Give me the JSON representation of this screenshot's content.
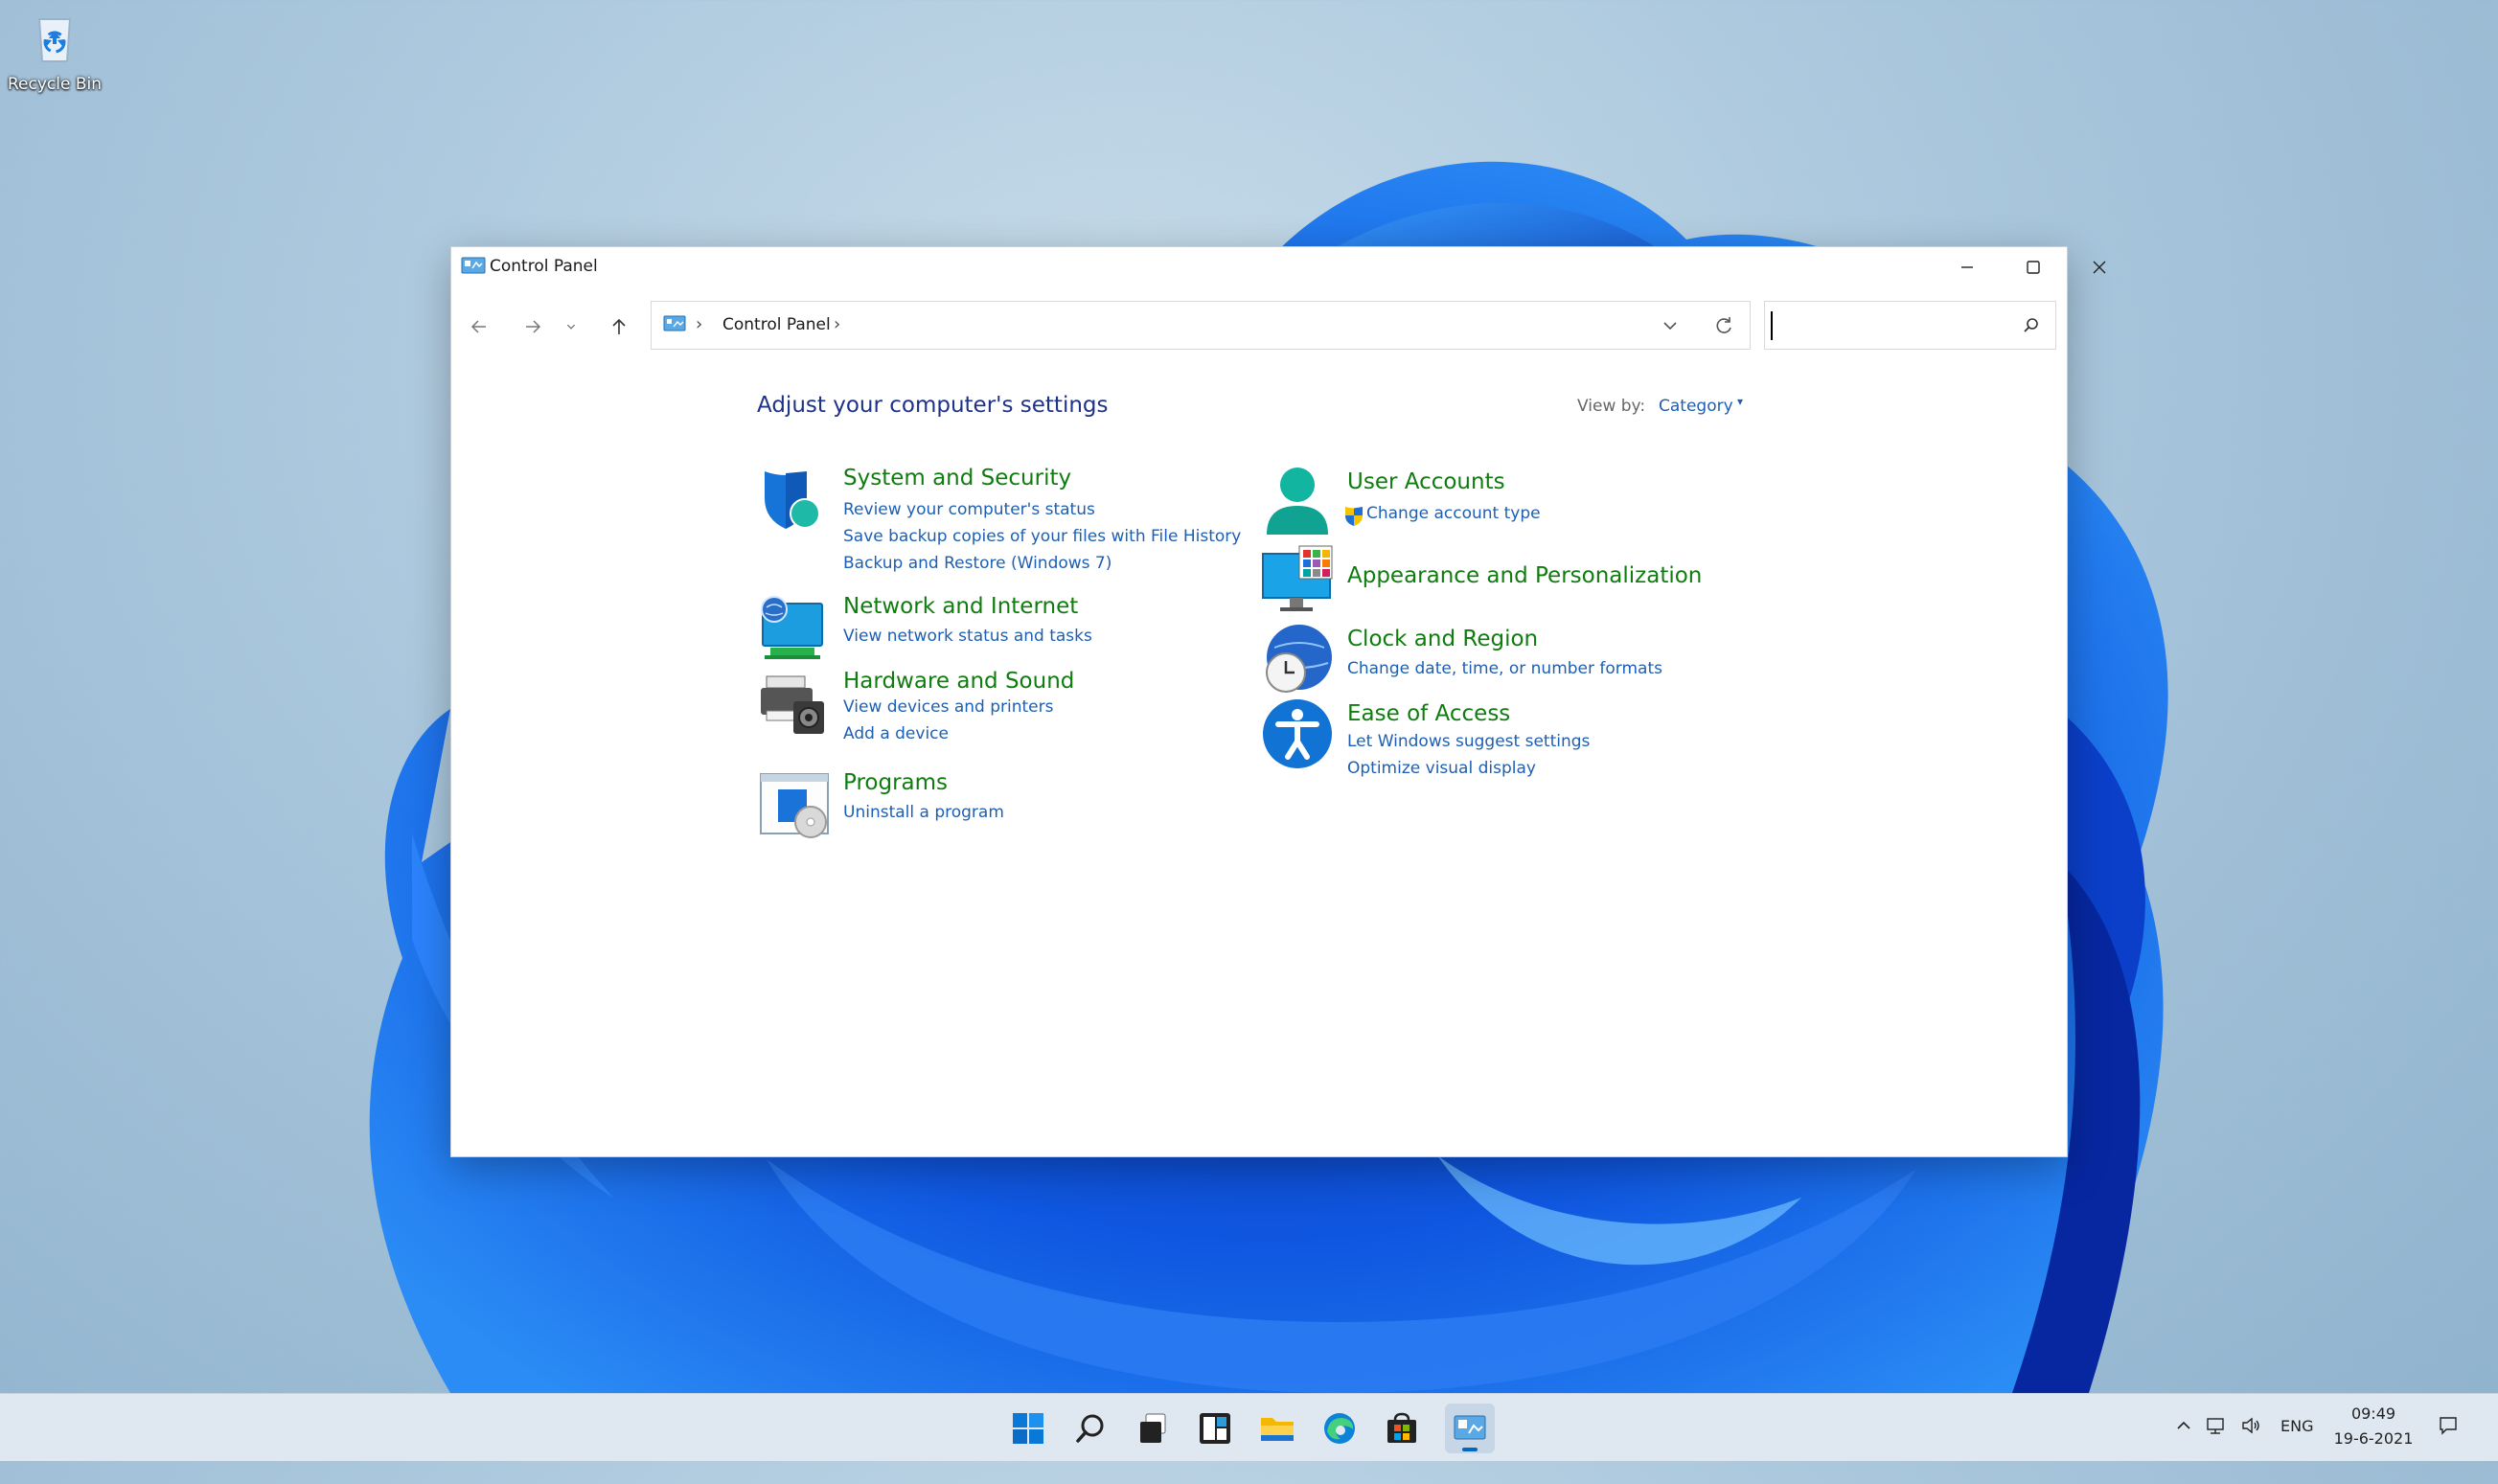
{
  "desktop": {
    "recycle_bin_label": "Recycle Bin"
  },
  "window": {
    "title": "Control Panel",
    "title_icon": "control-panel-icon",
    "buttons": [
      "minimize-icon",
      "maximize-icon",
      "close-icon"
    ]
  },
  "nav": {
    "back": "back-arrow-icon",
    "forward": "forward-arrow-icon",
    "recent": "chevron-down-icon",
    "up": "up-arrow-icon",
    "breadcrumb": "Control Panel",
    "search_value": ""
  },
  "content": {
    "heading": "Adjust your computer's settings",
    "view_by_label": "View by:",
    "view_by_value": "Category",
    "categories_left": [
      {
        "title": "System and Security",
        "icon": "shield-icon",
        "links": [
          "Review your computer's status",
          "Save backup copies of your files with File History",
          "Backup and Restore (Windows 7)"
        ]
      },
      {
        "title": "Network and Internet",
        "icon": "network-globe-icon",
        "links": [
          "View network status and tasks"
        ]
      },
      {
        "title": "Hardware and Sound",
        "icon": "printer-speaker-icon",
        "links": [
          "View devices and printers",
          "Add a device"
        ]
      },
      {
        "title": "Programs",
        "icon": "programs-disc-icon",
        "links": [
          "Uninstall a program"
        ]
      }
    ],
    "categories_right": [
      {
        "title": "User Accounts",
        "icon": "user-icon",
        "links": [
          "Change account type"
        ]
      },
      {
        "title": "Appearance and Personalization",
        "icon": "monitor-color-icon",
        "links": []
      },
      {
        "title": "Clock and Region",
        "icon": "clock-globe-icon",
        "links": [
          "Change date, time, or number formats"
        ]
      },
      {
        "title": "Ease of Access",
        "icon": "accessibility-icon",
        "links": [
          "Let Windows suggest settings",
          "Optimize visual display"
        ]
      }
    ]
  },
  "taskbar": {
    "apps": [
      "start-icon",
      "search-icon",
      "task-view-icon",
      "widgets-icon",
      "file-explorer-icon",
      "edge-icon",
      "store-icon",
      "control-panel-icon"
    ],
    "active_app": "control-panel-icon",
    "tray": {
      "language": "ENG",
      "time": "09:49",
      "date": "19-6-2021"
    }
  },
  "colors": {
    "link": "#1e5fb4",
    "category": "#107c10",
    "heading": "#1e3287",
    "accent": "#0067c0"
  }
}
